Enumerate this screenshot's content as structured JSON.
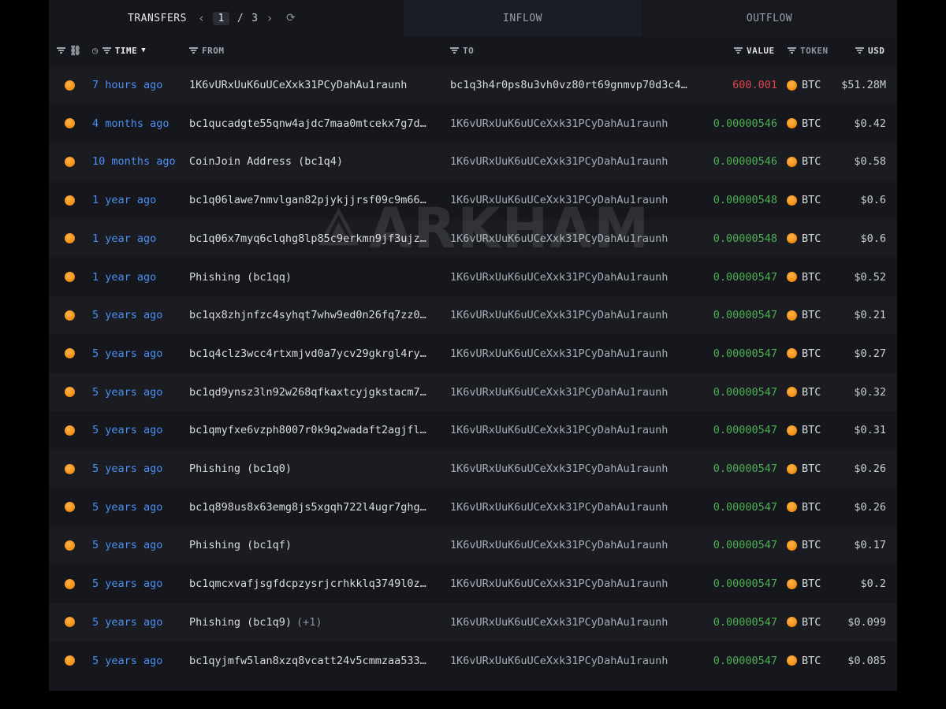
{
  "tabs": {
    "transfers": "TRANSFERS",
    "page_current": "1",
    "page_separator": "/",
    "page_total": "3",
    "inflow": "INFLOW",
    "outflow": "OUTFLOW"
  },
  "columns": {
    "time": "TIME",
    "from": "FROM",
    "to": "TO",
    "value": "VALUE",
    "token": "TOKEN",
    "usd": "USD"
  },
  "watermark": "ARKHAM",
  "rows": [
    {
      "time": "7 hours ago",
      "from": "1K6vURxUuK6uUCeXxk31PCyDahAu1raunh",
      "to": "bc1q3h4r0ps8u3vh0vz80rt69gnmvp70d3c4…",
      "value": "600.001",
      "token": "BTC",
      "usd": "$51.28M"
    },
    {
      "time": "4 months ago",
      "from": "bc1qucadgte55qnw4ajdc7maa0mtcekx7g7d…",
      "to": "1K6vURxUuK6uUCeXxk31PCyDahAu1raunh",
      "value": "0.00000546",
      "token": "BTC",
      "usd": "$0.42"
    },
    {
      "time": "10 months ago",
      "from": "CoinJoin Address (bc1q4)",
      "to": "1K6vURxUuK6uUCeXxk31PCyDahAu1raunh",
      "value": "0.00000546",
      "token": "BTC",
      "usd": "$0.58"
    },
    {
      "time": "1 year ago",
      "from": "bc1q06lawe7nmvlgan82pjykjjrsf09c9m66…",
      "to": "1K6vURxUuK6uUCeXxk31PCyDahAu1raunh",
      "value": "0.00000548",
      "token": "BTC",
      "usd": "$0.6"
    },
    {
      "time": "1 year ago",
      "from": "bc1q06x7myq6clqhg8lp85c9erkmn9jf3ujz…",
      "to": "1K6vURxUuK6uUCeXxk31PCyDahAu1raunh",
      "value": "0.00000548",
      "token": "BTC",
      "usd": "$0.6"
    },
    {
      "time": "1 year ago",
      "from": "Phishing (bc1qq)",
      "to": "1K6vURxUuK6uUCeXxk31PCyDahAu1raunh",
      "value": "0.00000547",
      "token": "BTC",
      "usd": "$0.52"
    },
    {
      "time": "5 years ago",
      "from": "bc1qx8zhjnfzc4syhqt7whw9ed0n26fq7zz0…",
      "to": "1K6vURxUuK6uUCeXxk31PCyDahAu1raunh",
      "value": "0.00000547",
      "token": "BTC",
      "usd": "$0.21"
    },
    {
      "time": "5 years ago",
      "from": "bc1q4clz3wcc4rtxmjvd0a7ycv29gkrgl4ry…",
      "to": "1K6vURxUuK6uUCeXxk31PCyDahAu1raunh",
      "value": "0.00000547",
      "token": "BTC",
      "usd": "$0.27"
    },
    {
      "time": "5 years ago",
      "from": "bc1qd9ynsz3ln92w268qfkaxtcyjgkstacm7…",
      "to": "1K6vURxUuK6uUCeXxk31PCyDahAu1raunh",
      "value": "0.00000547",
      "token": "BTC",
      "usd": "$0.32"
    },
    {
      "time": "5 years ago",
      "from": "bc1qmyfxe6vzph8007r0k9q2wadaft2agjfl…",
      "to": "1K6vURxUuK6uUCeXxk31PCyDahAu1raunh",
      "value": "0.00000547",
      "token": "BTC",
      "usd": "$0.31"
    },
    {
      "time": "5 years ago",
      "from": "Phishing (bc1q0)",
      "to": "1K6vURxUuK6uUCeXxk31PCyDahAu1raunh",
      "value": "0.00000547",
      "token": "BTC",
      "usd": "$0.26"
    },
    {
      "time": "5 years ago",
      "from": "bc1q898us8x63emg8js5xgqh722l4ugr7ghg…",
      "to": "1K6vURxUuK6uUCeXxk31PCyDahAu1raunh",
      "value": "0.00000547",
      "token": "BTC",
      "usd": "$0.26"
    },
    {
      "time": "5 years ago",
      "from": "Phishing (bc1qf)",
      "to": "1K6vURxUuK6uUCeXxk31PCyDahAu1raunh",
      "value": "0.00000547",
      "token": "BTC",
      "usd": "$0.17"
    },
    {
      "time": "5 years ago",
      "from": "bc1qmcxvafjsgfdcpzysrjcrhkklq3749l0z…",
      "to": "1K6vURxUuK6uUCeXxk31PCyDahAu1raunh",
      "value": "0.00000547",
      "token": "BTC",
      "usd": "$0.2"
    },
    {
      "time": "5 years ago",
      "from": "Phishing (bc1q9)",
      "from_extra": "(+1)",
      "to": "1K6vURxUuK6uUCeXxk31PCyDahAu1raunh",
      "value": "0.00000547",
      "token": "BTC",
      "usd": "$0.099"
    },
    {
      "time": "5 years ago",
      "from": "bc1qyjmfw5lan8xzq8vcatt24v5cmmzaa533…",
      "to": "1K6vURxUuK6uUCeXxk31PCyDahAu1raunh",
      "value": "0.00000547",
      "token": "BTC",
      "usd": "$0.085"
    }
  ],
  "colors": {
    "time_link": "#4b8ff1",
    "value_in": "#4caf50",
    "value_out": "#e0454b",
    "btc": "#f7931a"
  }
}
